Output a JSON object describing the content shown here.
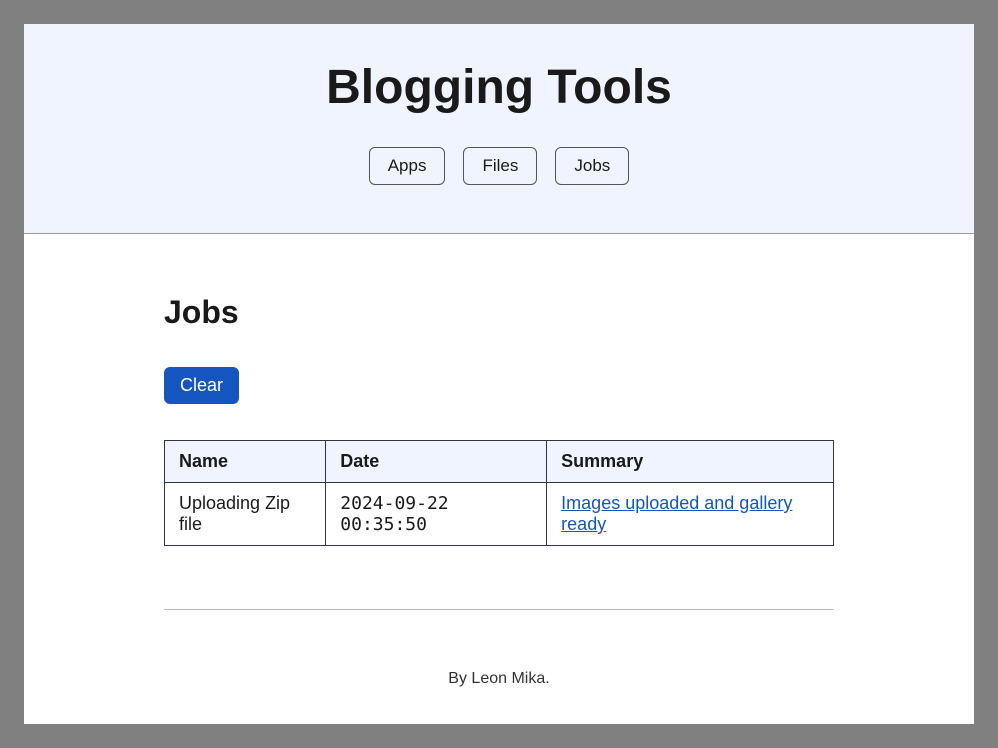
{
  "header": {
    "title": "Blogging Tools",
    "nav": [
      {
        "label": "Apps"
      },
      {
        "label": "Files"
      },
      {
        "label": "Jobs"
      }
    ]
  },
  "main": {
    "title": "Jobs",
    "clear_label": "Clear",
    "table": {
      "headers": {
        "name": "Name",
        "date": "Date",
        "summary": "Summary"
      },
      "rows": [
        {
          "name": "Uploading Zip file",
          "date": "2024-09-22 00:35:50",
          "summary": "Images uploaded and gallery ready"
        }
      ]
    }
  },
  "footer": {
    "text": "By Leon Mika."
  }
}
